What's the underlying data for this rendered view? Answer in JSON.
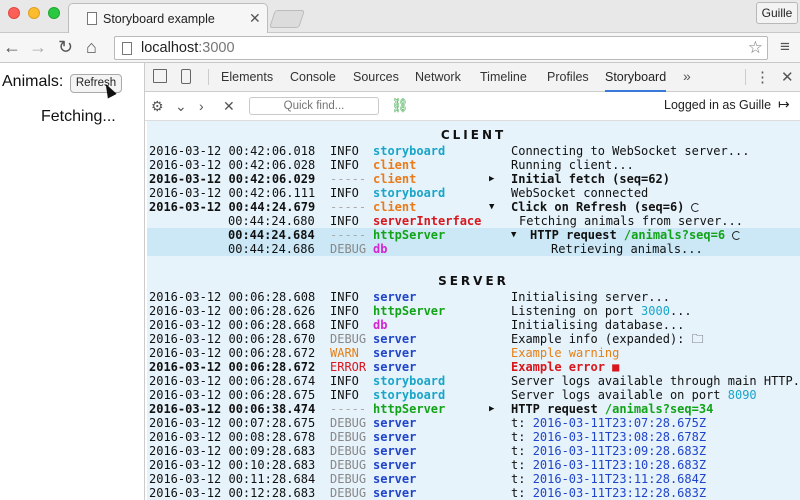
{
  "browser": {
    "tab_title": "Storyboard example",
    "profile": "Guille",
    "url_host": "localhost",
    "url_port": ":3000"
  },
  "page": {
    "animals_label": "Animals:",
    "refresh_label": "Refresh",
    "status": "Fetching..."
  },
  "devtools": {
    "tabs": [
      "Elements",
      "Console",
      "Sources",
      "Network",
      "Timeline",
      "Profiles",
      "Storyboard"
    ],
    "active_tab": "Storyboard",
    "quick_find_placeholder": "Quick find...",
    "logged_in": "Logged in as Guille"
  },
  "log": {
    "client_title": "CLIENT",
    "server_title": "SERVER",
    "client_rows": [
      {
        "ts": "2016-03-12 00:42:06.018",
        "lvl": "INFO",
        "src": "storyboard",
        "arrow": "",
        "msg": "Connecting to WebSocket server...",
        "bold": false
      },
      {
        "ts": "2016-03-12 00:42:06.028",
        "lvl": "INFO",
        "src": "client",
        "arrow": "",
        "msg": "Running client...",
        "bold": false
      },
      {
        "ts": "2016-03-12 00:42:06.029",
        "lvl": "-----",
        "src": "client",
        "arrow": "▶",
        "msg": "Initial fetch (seq=62)",
        "bold": true
      },
      {
        "ts": "2016-03-12 00:42:06.111",
        "lvl": "INFO",
        "src": "storyboard",
        "arrow": "",
        "msg": "WebSocket connected",
        "bold": false
      },
      {
        "ts": "2016-03-12 00:44:24.679",
        "lvl": "-----",
        "src": "client",
        "arrow": "▼",
        "msg": "Click on Refresh (seq=6)",
        "bold": true
      },
      {
        "ts": "00:44:24.680",
        "lvl": "INFO",
        "src": "serverInterface",
        "arrow": "",
        "msg": "Fetching animals from server...",
        "bold": false
      },
      {
        "ts": "00:44:24.684",
        "lvl": "-----",
        "src": "httpServer",
        "arrow": "▼",
        "msg": "HTTP request /animals?seq=6",
        "bold": true
      },
      {
        "ts": "00:44:24.686",
        "lvl": "DEBUG",
        "src": "db",
        "arrow": "",
        "msg": "Retrieving animals...",
        "bold": false
      }
    ],
    "server_rows": [
      {
        "ts": "2016-03-12 00:06:28.608",
        "lvl": "INFO",
        "src": "server",
        "arrow": "",
        "msg": "Initialising server...",
        "bold": false
      },
      {
        "ts": "2016-03-12 00:06:28.626",
        "lvl": "INFO",
        "src": "httpServer",
        "arrow": "",
        "msg": "Listening on port 3000...",
        "bold": false
      },
      {
        "ts": "2016-03-12 00:06:28.668",
        "lvl": "INFO",
        "src": "db",
        "arrow": "",
        "msg": "Initialising database...",
        "bold": false
      },
      {
        "ts": "2016-03-12 00:06:28.670",
        "lvl": "DEBUG",
        "src": "server",
        "arrow": "",
        "msg": "Example info (expanded):",
        "bold": false
      },
      {
        "ts": "2016-03-12 00:06:28.672",
        "lvl": "WARN",
        "src": "server",
        "arrow": "",
        "msg": "Example warning",
        "bold": false
      },
      {
        "ts": "2016-03-12 00:06:28.672",
        "lvl": "ERROR",
        "src": "server",
        "arrow": "",
        "msg": "Example error",
        "bold": true
      },
      {
        "ts": "2016-03-12 00:06:28.674",
        "lvl": "INFO",
        "src": "storyboard",
        "arrow": "",
        "msg": "Server logs available through main HTTP...",
        "bold": false
      },
      {
        "ts": "2016-03-12 00:06:28.675",
        "lvl": "INFO",
        "src": "storyboard",
        "arrow": "",
        "msg": "Server logs available on port 8090",
        "bold": false
      },
      {
        "ts": "2016-03-12 00:06:38.474",
        "lvl": "-----",
        "src": "httpServer",
        "arrow": "▶",
        "msg": "HTTP request /animals?seq=34",
        "bold": true
      },
      {
        "ts": "2016-03-12 00:07:28.675",
        "lvl": "DEBUG",
        "src": "server",
        "arrow": "",
        "msg": "t: 2016-03-11T23:07:28.675Z",
        "bold": false
      },
      {
        "ts": "2016-03-12 00:08:28.678",
        "lvl": "DEBUG",
        "src": "server",
        "arrow": "",
        "msg": "t: 2016-03-11T23:08:28.678Z",
        "bold": false
      },
      {
        "ts": "2016-03-12 00:09:28.683",
        "lvl": "DEBUG",
        "src": "server",
        "arrow": "",
        "msg": "t: 2016-03-11T23:09:28.683Z",
        "bold": false
      },
      {
        "ts": "2016-03-12 00:10:28.683",
        "lvl": "DEBUG",
        "src": "server",
        "arrow": "",
        "msg": "t: 2016-03-11T23:10:28.683Z",
        "bold": false
      },
      {
        "ts": "2016-03-12 00:11:28.684",
        "lvl": "DEBUG",
        "src": "server",
        "arrow": "",
        "msg": "t: 2016-03-11T23:11:28.684Z",
        "bold": false
      },
      {
        "ts": "2016-03-12 00:12:28.683",
        "lvl": "DEBUG",
        "src": "server",
        "arrow": "",
        "msg": "t: 2016-03-11T23:12:28.683Z",
        "bold": false
      }
    ]
  }
}
